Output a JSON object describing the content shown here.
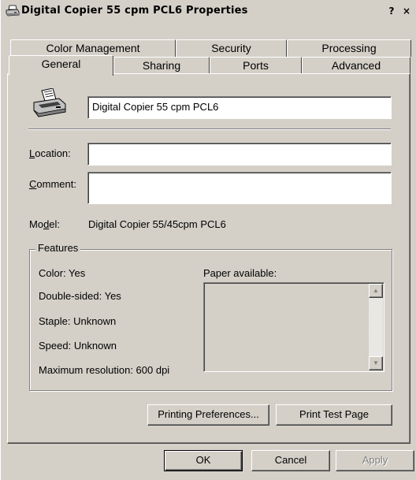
{
  "window": {
    "title": "Digital Copier 55 cpm PCL6 Properties",
    "help_button": "?",
    "close_button": "×"
  },
  "tabs": {
    "row_back": [
      "Color Management",
      "Security",
      "Processing"
    ],
    "row_front": [
      "General",
      "Sharing",
      "Ports",
      "Advanced"
    ],
    "active": "General"
  },
  "general": {
    "printer_name": "Digital Copier 55 cpm PCL6",
    "location_label": "Location:",
    "location_value": "",
    "comment_label": "Comment:",
    "comment_value": "",
    "model_label": "Model:",
    "model_value": "Digital Copier 55/45cpm PCL6"
  },
  "features": {
    "group_title": "Features",
    "color": "Color: Yes",
    "double_sided": "Double-sided: Yes",
    "staple": "Staple: Unknown",
    "speed": "Speed: Unknown",
    "max_resolution": "Maximum resolution: 600 dpi",
    "paper_label": "Paper available:",
    "paper_items": []
  },
  "buttons": {
    "printing_preferences": "Printing Preferences...",
    "print_test_page": "Print Test Page",
    "ok": "OK",
    "cancel": "Cancel",
    "apply": "Apply"
  }
}
